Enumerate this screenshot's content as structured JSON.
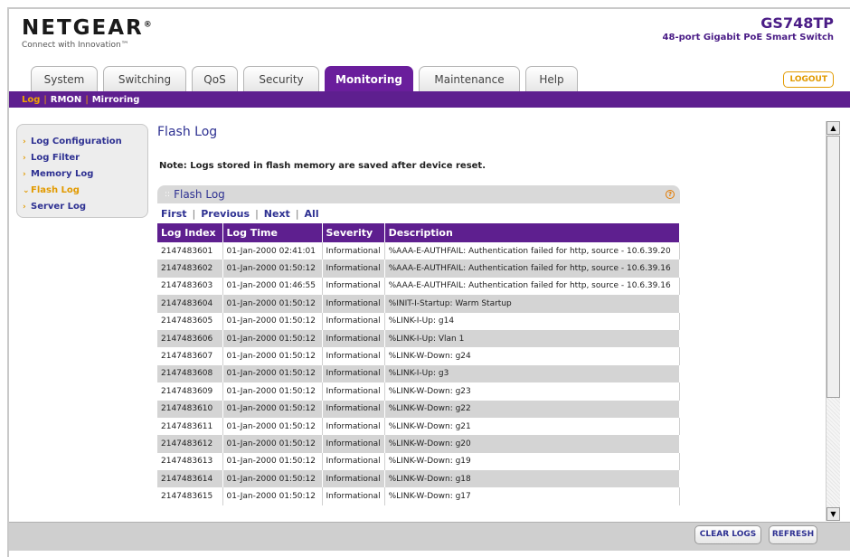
{
  "header": {
    "logo": "NETGEAR",
    "logo_mark": "®",
    "tagline": "Connect with Innovation™",
    "model": "GS748TP",
    "model_desc": "48-port Gigabit PoE Smart Switch"
  },
  "tabs": [
    {
      "label": "System"
    },
    {
      "label": "Switching"
    },
    {
      "label": "QoS"
    },
    {
      "label": "Security"
    },
    {
      "label": "Monitoring"
    },
    {
      "label": "Maintenance"
    },
    {
      "label": "Help"
    }
  ],
  "active_tab": "Monitoring",
  "logout_label": "LOGOUT",
  "subnav": [
    "Log",
    "RMON",
    "Mirroring"
  ],
  "sidebar": [
    {
      "label": "Log Configuration"
    },
    {
      "label": "Log Filter"
    },
    {
      "label": "Memory Log"
    },
    {
      "label": "Flash Log"
    },
    {
      "label": "Server Log"
    }
  ],
  "page": {
    "title": "Flash Log",
    "note": "Note: Logs stored in flash memory are saved after device reset."
  },
  "panel": {
    "title": "Flash Log",
    "help_icon": "question-icon",
    "pager": [
      "First",
      "Previous",
      "Next",
      "All"
    ]
  },
  "table": {
    "headers": [
      "Log Index",
      "Log Time",
      "Severity",
      "Description"
    ],
    "rows": [
      [
        "2147483601",
        "01-Jan-2000 02:41:01",
        "Informational",
        "%AAA-E-AUTHFAIL: Authentication failed for http, source - 10.6.39.20"
      ],
      [
        "2147483602",
        "01-Jan-2000 01:50:12",
        "Informational",
        "%AAA-E-AUTHFAIL: Authentication failed for http, source - 10.6.39.16"
      ],
      [
        "2147483603",
        "01-Jan-2000 01:46:55",
        "Informational",
        "%AAA-E-AUTHFAIL: Authentication failed for http, source - 10.6.39.16"
      ],
      [
        "2147483604",
        "01-Jan-2000 01:50:12",
        "Informational",
        "%INIT-I-Startup: Warm Startup"
      ],
      [
        "2147483605",
        "01-Jan-2000 01:50:12",
        "Informational",
        "%LINK-I-Up: g14"
      ],
      [
        "2147483606",
        "01-Jan-2000 01:50:12",
        "Informational",
        "%LINK-I-Up: Vlan 1"
      ],
      [
        "2147483607",
        "01-Jan-2000 01:50:12",
        "Informational",
        "%LINK-W-Down: g24"
      ],
      [
        "2147483608",
        "01-Jan-2000 01:50:12",
        "Informational",
        "%LINK-I-Up: g3"
      ],
      [
        "2147483609",
        "01-Jan-2000 01:50:12",
        "Informational",
        "%LINK-W-Down: g23"
      ],
      [
        "2147483610",
        "01-Jan-2000 01:50:12",
        "Informational",
        "%LINK-W-Down: g22"
      ],
      [
        "2147483611",
        "01-Jan-2000 01:50:12",
        "Informational",
        "%LINK-W-Down: g21"
      ],
      [
        "2147483612",
        "01-Jan-2000 01:50:12",
        "Informational",
        "%LINK-W-Down: g20"
      ],
      [
        "2147483613",
        "01-Jan-2000 01:50:12",
        "Informational",
        "%LINK-W-Down: g19"
      ],
      [
        "2147483614",
        "01-Jan-2000 01:50:12",
        "Informational",
        "%LINK-W-Down: g18"
      ],
      [
        "2147483615",
        "01-Jan-2000 01:50:12",
        "Informational",
        "%LINK-W-Down: g17"
      ]
    ]
  },
  "footer": {
    "clear_label": "CLEAR LOGS",
    "refresh_label": "REFRESH"
  },
  "colors": {
    "brand_purple": "#5e1f8f",
    "accent_orange": "#e29a00",
    "link_blue": "#2e3192"
  }
}
